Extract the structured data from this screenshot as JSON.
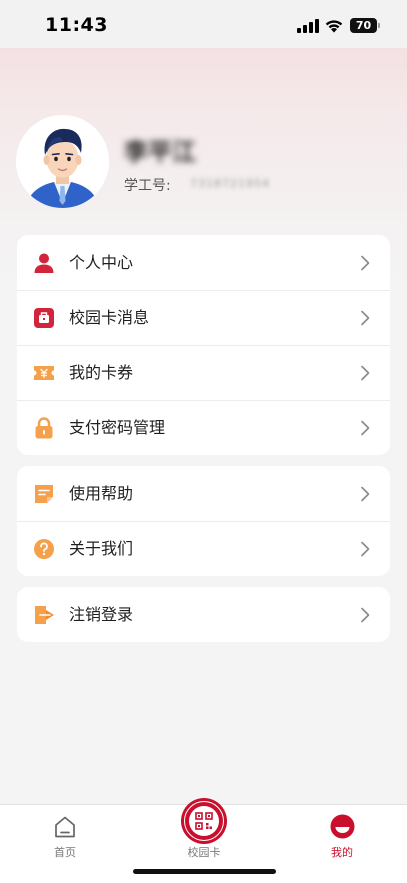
{
  "status_bar": {
    "time": "11:43",
    "battery": "70"
  },
  "profile": {
    "name": "李平江",
    "id_label": "学工号:",
    "id_value": "7318721954"
  },
  "menu_groups": [
    [
      {
        "label": "个人中心",
        "icon": "user-icon"
      },
      {
        "label": "校园卡消息",
        "icon": "message-icon"
      },
      {
        "label": "我的卡券",
        "icon": "coupon-icon"
      },
      {
        "label": "支付密码管理",
        "icon": "lock-icon"
      }
    ],
    [
      {
        "label": "使用帮助",
        "icon": "help-doc-icon"
      },
      {
        "label": "关于我们",
        "icon": "question-icon"
      }
    ],
    [
      {
        "label": "注销登录",
        "icon": "logout-icon"
      }
    ]
  ],
  "tabbar": {
    "home": "首页",
    "campus_card": "校园卡",
    "mine": "我的",
    "active_tab": "我的"
  },
  "colors": {
    "accent": "#c8102e",
    "icon_red": "#d2243a",
    "icon_orange": "#f5a04a"
  }
}
